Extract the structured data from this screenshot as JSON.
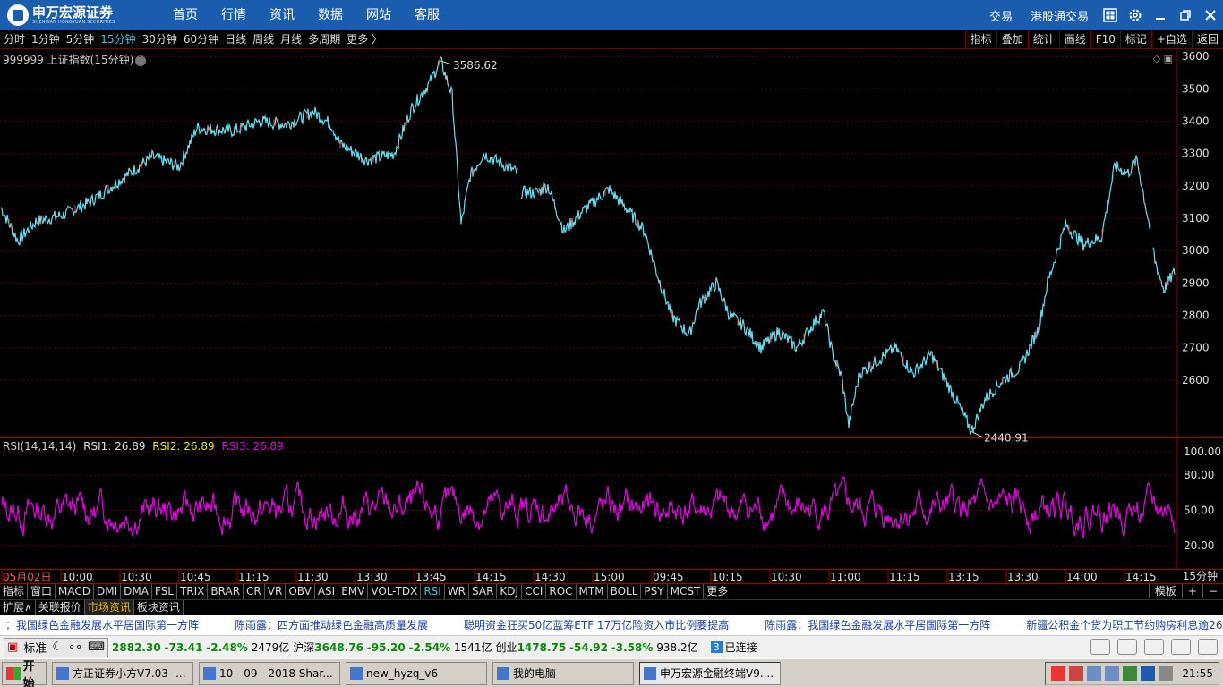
{
  "window": {
    "logo_text": "申万宏源证券",
    "logo_sub": "SHENWAN HONGYUAN SECURITIES",
    "nav": [
      "首页",
      "行情",
      "资讯",
      "数据",
      "网站",
      "客服"
    ],
    "right_links": [
      "交易",
      "港股通交易"
    ]
  },
  "periods": {
    "items": [
      "分时",
      "1分钟",
      "5分钟",
      "15分钟",
      "30分钟",
      "60分钟",
      "日线",
      "周线",
      "月线",
      "多周期",
      "更多 〉"
    ],
    "active": "15分钟"
  },
  "tools": [
    "指标",
    "叠加",
    "统计",
    "画线",
    "F10",
    "标记",
    "+自选",
    "返回"
  ],
  "main_chart": {
    "title": "999999 上证指数(15分钟)",
    "high_label": "3586.62",
    "low_label": "2440.91",
    "price_ticks": [
      "3600",
      "3500",
      "3400",
      "3300",
      "3200",
      "3100",
      "3000",
      "2900",
      "2800",
      "2700",
      "2600"
    ]
  },
  "rsi": {
    "name": "RSI(14,14,14)",
    "rsi1": "RSI1: 26.89",
    "rsi2": "RSI2: 26.89",
    "rsi3": "RSI3: 26.89",
    "ticks": [
      "100.00",
      "80.00",
      "50.00",
      "20.00"
    ],
    "colors": {
      "rsi1": "#e0e0e0",
      "rsi2": "#e6e600",
      "rsi3": "#e600e6"
    }
  },
  "time_axis": {
    "labels": [
      "05月02日",
      "10:00",
      "10:30",
      "10:45",
      "11:15",
      "11:30",
      "13:30",
      "13:45",
      "14:15",
      "14:30",
      "15:00",
      "09:45",
      "10:15",
      "10:30",
      "11:00",
      "11:15",
      "13:15",
      "13:30",
      "14:00",
      "14:15"
    ],
    "period": "15分钟"
  },
  "indicator_tabs": [
    "指标",
    "窗口",
    "MACD",
    "DMI",
    "DMA",
    "FSL",
    "TRIX",
    "BRAR",
    "CR",
    "VR",
    "OBV",
    "ASI",
    "EMV",
    "VOL-TDX",
    "RSI",
    "WR",
    "SAR",
    "KDJ",
    "CCI",
    "ROC",
    "MTM",
    "BOLL",
    "PSY",
    "MCST",
    "更多"
  ],
  "indicator_active": "RSI",
  "indicator_right": [
    "模板",
    "+",
    "−"
  ],
  "bottom_tabs": [
    "扩展∧",
    "关联报价",
    "市场资讯",
    "板块资讯"
  ],
  "bottom_active": "市场资讯",
  "news": [
    "：我国绿色金融发展水平居国际第一方阵",
    "陈雨露：四方面推动绿色金融高质量发展",
    "聪明资金狂买50亿蓝筹ETF 17万亿险资入市比例要提高",
    "陈雨露：我国绿色金融发展水平居国际第一方阵",
    "新疆公积金个贷为职工节约购房利息逾26亿"
  ],
  "index_bar": {
    "mode": "标准",
    "sh": {
      "value": "2882.30",
      "change": "-73.41",
      "pct": "-2.48%",
      "amount": "2479亿"
    },
    "hs_label": "沪深",
    "hs": {
      "value": "3648.76",
      "change": "-95.20",
      "pct": "-2.54%",
      "amount": "1541亿"
    },
    "cy_label": "创业",
    "cy": {
      "value": "1478.75",
      "change": "-54.92",
      "pct": "-3.58%",
      "amount": "938.2亿"
    },
    "conn_count": "3",
    "conn_text": "已连接"
  },
  "taskbar": {
    "start": "开始",
    "tasks": [
      "方正证券小方V7.03 -...",
      "10 - 09 - 2018 Shar...",
      "new_hyzq_v6",
      "我的电脑",
      "申万宏源金融终端V9...."
    ],
    "active": "申万宏源金融终端V9....",
    "clock": "21:55"
  }
}
